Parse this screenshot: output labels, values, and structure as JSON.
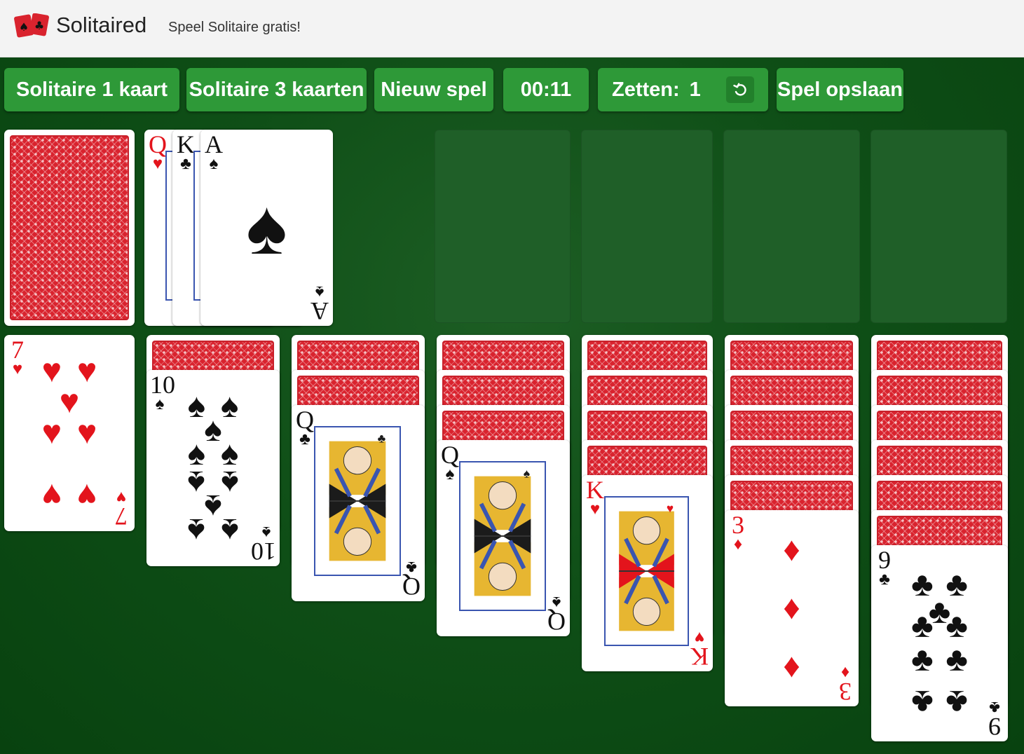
{
  "header": {
    "brand": "Solitaired",
    "tagline": "Speel Solitaire gratis!",
    "logo_icon": "two-playing-cards-logo"
  },
  "toolbar": {
    "one_card_label": "Solitaire 1 kaart",
    "three_cards_label": "Solitaire 3 kaarten",
    "new_game_label": "Nieuw spel",
    "timer": "00:11",
    "moves_label": "Zetten:",
    "moves_value": "1",
    "undo_icon": "undo-icon",
    "save_label": "Spel opslaan"
  },
  "colors": {
    "felt": "#0f4f17",
    "button": "#2e9938",
    "card_back": "#d9232e",
    "red_suit": "#e3141c",
    "black_suit": "#111111"
  },
  "game": {
    "stock": {
      "cards_face_down": true
    },
    "waste": [
      {
        "rank": "Q",
        "suit": "♥",
        "color": "red"
      },
      {
        "rank": "K",
        "suit": "♣",
        "color": "black"
      },
      {
        "rank": "A",
        "suit": "♠",
        "color": "black"
      }
    ],
    "foundations": [
      {
        "cards": 0
      },
      {
        "cards": 0
      },
      {
        "cards": 0
      },
      {
        "cards": 0
      }
    ],
    "tableau": [
      {
        "face_down": 0,
        "top": {
          "rank": "7",
          "suit": "♥",
          "color": "red"
        }
      },
      {
        "face_down": 1,
        "top": {
          "rank": "10",
          "suit": "♠",
          "color": "black"
        }
      },
      {
        "face_down": 2,
        "top": {
          "rank": "Q",
          "suit": "♣",
          "color": "black"
        }
      },
      {
        "face_down": 3,
        "top": {
          "rank": "Q",
          "suit": "♠",
          "color": "black"
        }
      },
      {
        "face_down": 4,
        "top": {
          "rank": "K",
          "suit": "♥",
          "color": "red"
        }
      },
      {
        "face_down": 5,
        "top": {
          "rank": "3",
          "suit": "♦",
          "color": "red"
        }
      },
      {
        "face_down": 6,
        "top": {
          "rank": "9",
          "suit": "♣",
          "color": "black"
        }
      }
    ]
  }
}
